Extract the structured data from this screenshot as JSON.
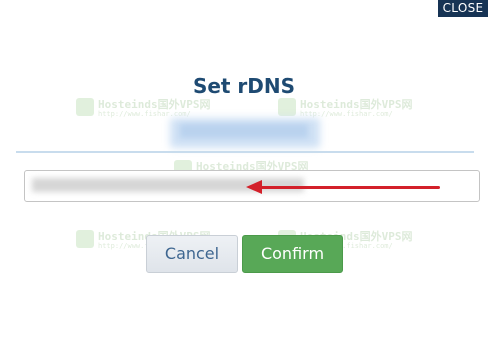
{
  "dialog": {
    "close_label": "CLOSE",
    "title": "Set rDNS",
    "ip_address": "",
    "input": {
      "value": "",
      "placeholder": ""
    }
  },
  "buttons": {
    "cancel_label": "Cancel",
    "confirm_label": "Confirm"
  },
  "annotation": {
    "arrow_color": "#d3202a",
    "direction": "left"
  },
  "watermark": {
    "text": "Hosteinds国外VPS网",
    "subtext": "http://www.fishar.com/"
  },
  "colors": {
    "title": "#1e4a72",
    "close_bg": "#163354",
    "confirm_bg": "#58a857",
    "cancel_text": "#3e6690"
  }
}
